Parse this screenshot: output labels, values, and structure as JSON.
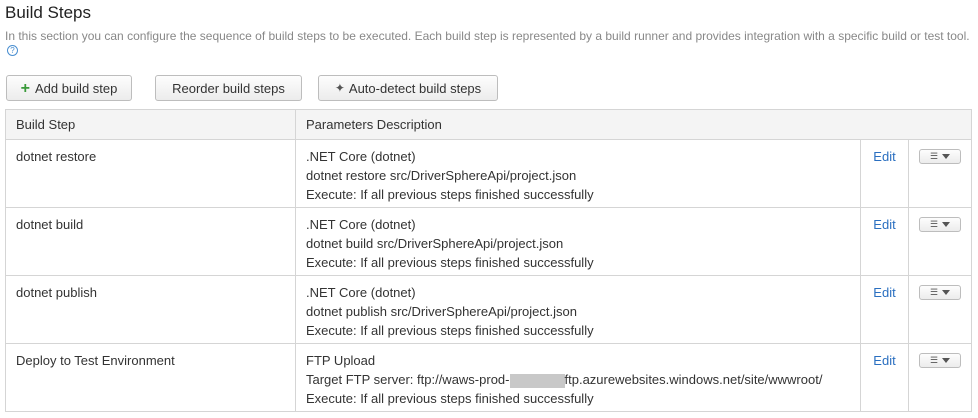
{
  "page": {
    "title": "Build Steps",
    "description": "In this section you can configure the sequence of build steps to be executed. Each build step is represented by a build runner and provides integration with a specific build or test tool."
  },
  "toolbar": {
    "add_label": "Add build step",
    "reorder_label": "Reorder build steps",
    "autodetect_label": "Auto-detect build steps"
  },
  "table": {
    "headers": {
      "step": "Build Step",
      "params": "Parameters Description"
    },
    "edit_label": "Edit",
    "rows": [
      {
        "name": "dotnet restore",
        "runner": ".NET Core (dotnet)",
        "detail": "dotnet restore src/DriverSphereApi/project.json",
        "execute": "Execute: If all previous steps finished successfully"
      },
      {
        "name": "dotnet build",
        "runner": ".NET Core (dotnet)",
        "detail": "dotnet build src/DriverSphereApi/project.json",
        "execute": "Execute: If all previous steps finished successfully"
      },
      {
        "name": "dotnet publish",
        "runner": ".NET Core (dotnet)",
        "detail": "dotnet publish src/DriverSphereApi/project.json",
        "execute": "Execute: If all previous steps finished successfully"
      },
      {
        "name": "Deploy to Test Environment",
        "runner": "FTP Upload",
        "detail_prefix": "Target FTP server: ftp://waws-prod-",
        "detail_suffix": "ftp.azurewebsites.windows.net/site/wwwroot/",
        "execute": "Execute: If all previous steps finished successfully"
      }
    ]
  },
  "icons": {
    "help": "help-circle-icon",
    "add": "plus-icon",
    "autodetect": "magic-wand-icon",
    "menu": "list-icon",
    "caret": "caret-down-icon"
  },
  "colors": {
    "link": "#2a6fc0",
    "plus": "#3a9a3a",
    "help": "#4a8fd1"
  }
}
